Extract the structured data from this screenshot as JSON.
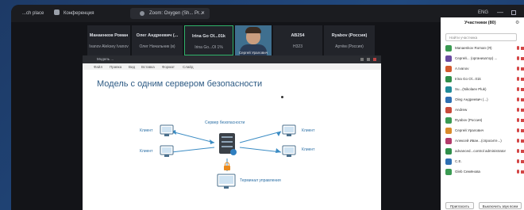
{
  "titlebar": {
    "app_label": "...ch place",
    "conference_label": "Конференция",
    "tab_label": "Zoom: Oxygen (Sh... Pr...",
    "right_label": "ENG"
  },
  "participants_strip": [
    {
      "name": "Манаенков Роман",
      "sub": "Ivanov Aleksey Ivanov",
      "active": false,
      "face": false
    },
    {
      "name": "Олег Андреевич (...",
      "sub": "Олег Начальник (в)",
      "active": false,
      "face": false
    },
    {
      "name": "Irina Go Ol...01k",
      "sub": "Irina Go...Ol 1%",
      "active": true,
      "face": false
    },
    {
      "name": "",
      "sub": "Сергей Уралович",
      "active": false,
      "face": true
    },
    {
      "name": "AB254",
      "sub": "H323",
      "active": false,
      "face": false
    },
    {
      "name": "Ryabov (Россия)",
      "sub": "Артём (Россия)",
      "active": false,
      "face": false
    }
  ],
  "document": {
    "title": "Модель ...",
    "menu": [
      "Файл",
      "Правка",
      "Вид",
      "Вставка",
      "Формат",
      "Слайд"
    ]
  },
  "slide": {
    "title": "Модель с одним сервером безопасности",
    "labels": {
      "server": "Сервер безопасности",
      "client_tl": "Клиент",
      "client_bl": "Клиент",
      "client_tr": "Клиент",
      "client_br": "Клиент",
      "terminal": "Терминал управления"
    }
  },
  "panel": {
    "title": "Участники (80)",
    "search_placeholder": "Найти участника",
    "participants": [
      {
        "name": "Manaenkov Roman (Я)",
        "color": "#3a9a52"
      },
      {
        "name": "Сергей... (организатор) ...",
        "color": "#6a4aa0"
      },
      {
        "name": "A.Ivanov",
        "color": "#d35a2e"
      },
      {
        "name": "Irina Go Ol...01k",
        "color": "#2f8e4a"
      },
      {
        "name": "Su...(Nikolaev Pluk)",
        "color": "#1f8a99"
      },
      {
        "name": "Oleg Андреевич (...)",
        "color": "#2e6fb2"
      },
      {
        "name": "Andrew",
        "color": "#c94a3a"
      },
      {
        "name": "Ryabov (Россия)",
        "color": "#3a9a52"
      },
      {
        "name": "Сергей Уралович",
        "color": "#d98a2a"
      },
      {
        "name": "Алексей Иван...(спросите...)",
        "color": "#b23a6a"
      },
      {
        "name": "advanced...control administrator",
        "color": "#2f8e4a"
      },
      {
        "name": "C.E.",
        "color": "#2e6fb2"
      },
      {
        "name": "Gleb Семёнова",
        "color": "#3a9a52"
      }
    ],
    "invite_button": "Пригласить",
    "mute_all_button": "Выключить звук всем"
  }
}
